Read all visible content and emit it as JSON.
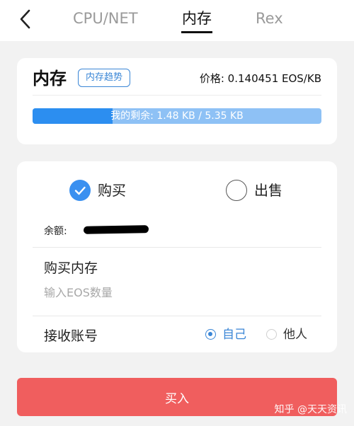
{
  "nav": {
    "tabs": [
      {
        "label": "CPU/NET",
        "active": false
      },
      {
        "label": "内存",
        "active": true
      },
      {
        "label": "Rex",
        "active": false
      }
    ]
  },
  "memory": {
    "title": "内存",
    "trend_button": "内存趋势",
    "price": "价格: 0.140451 EOS/KB",
    "remaining_text": "我的剩余: 1.48 KB / 5.35 KB",
    "remaining_fraction": 0.277
  },
  "trade": {
    "options": [
      {
        "label": "购买",
        "selected": true
      },
      {
        "label": "出售",
        "selected": false
      }
    ],
    "balance_label": "余额:",
    "buy_memory_label": "购买内存",
    "amount_placeholder": "输入EOS数量",
    "receiver_label": "接收账号",
    "receiver_options": [
      {
        "label": "自己",
        "selected": true
      },
      {
        "label": "他人",
        "selected": false
      }
    ]
  },
  "buy_button": "买入",
  "watermark": "知乎 @天天资讯",
  "colors": {
    "accent": "#3a86d6",
    "bar_fill": "#2c8ef0",
    "bar_track": "#8ec1f5",
    "buy_button": "#f05e5e"
  }
}
